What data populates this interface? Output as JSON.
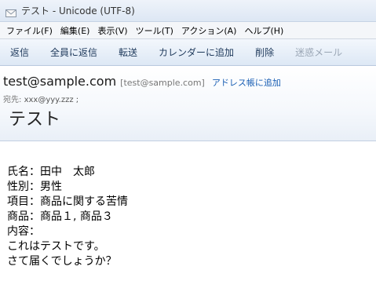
{
  "window": {
    "title": "テスト - Unicode (UTF-8)",
    "icon": "envelope-icon"
  },
  "menu": [
    "ファイル(F)",
    "編集(E)",
    "表示(V)",
    "ツール(T)",
    "アクション(A)",
    "ヘルプ(H)"
  ],
  "toolbar": {
    "reply": "返信",
    "reply_all": "全員に返信",
    "forward": "転送",
    "add_to_calendar": "カレンダーに追加",
    "delete": "削除",
    "junk": "迷惑メール"
  },
  "message": {
    "sender_name": "test@sample.com",
    "sender_address": "[test@sample.com]",
    "add_to_contacts": "アドレス帳に追加",
    "to_label": "宛先:",
    "to_value": "xxx@yyy.zzz ;",
    "subject": "テスト",
    "body_lines": [
      "氏名：田中　太郎",
      "性別：男性",
      "項目：商品に関する苦情",
      "商品：商品１, 商品３",
      "内容：",
      "これはテストです。",
      "さて届くでしょうか？"
    ]
  },
  "colors": {
    "link": "#1a5fb4",
    "toolbar_text": "#1e395b",
    "disabled_text": "#9aa6b5"
  }
}
